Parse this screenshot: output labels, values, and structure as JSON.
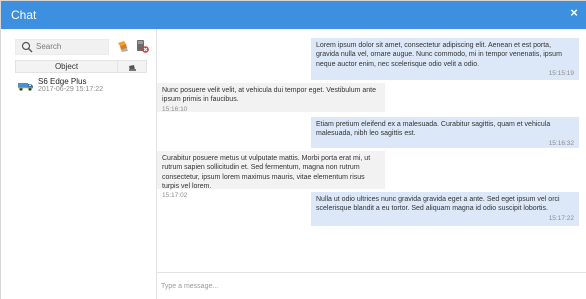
{
  "window": {
    "title": "Chat",
    "close_glyph": "×"
  },
  "sidebar": {
    "search_placeholder": "Search",
    "tools": [
      {
        "name": "vehicle-tool-icon"
      },
      {
        "name": "delete-tool-icon"
      }
    ],
    "grid": {
      "columns": [
        "Object",
        "image-icon"
      ],
      "rows": [
        {
          "name": "S6 Edge Plus",
          "time": "2017-06-29 15:17:22",
          "icon": "truck-icon"
        }
      ]
    }
  },
  "chat": {
    "messages": [
      {
        "dir": "out",
        "text": "Lorem ipsum dolor sit amet, consectetur adipiscing elit. Aenean et est porta, gravida nulla vel, ornare augue. Nunc commodo, mi in tempor venenatis, ipsum neque auctor enim, nec scelerisque odio velit a odio.",
        "time": "15:15:19"
      },
      {
        "dir": "in",
        "text": "Nunc posuere velit velit, at vehicula dui tempor eget. Vestibulum ante ipsum primis in faucibus.",
        "time": "15:16:10"
      },
      {
        "dir": "out",
        "text": "Etiam pretium eleifend ex a malesuada. Curabitur sagittis, quam et vehicula malesuada, nibh leo sagittis est.",
        "time": "15:16:32"
      },
      {
        "dir": "in",
        "text": "Curabitur posuere metus ut vulputate mattis. Morbi porta erat mi, ut rutrum sapien sollicitudin et. Sed fermentum, magna non rutrum consectetur, ipsum lorem maximus mauris, vitae elementum risus turpis vel lorem.",
        "time": "15:17:02"
      },
      {
        "dir": "out",
        "text": "Nulla ut odio ultrices nunc gravida gravida eget a ante. Sed eget ipsum vel orci scelerisque blandit a eu tortor. Sed aliquam magna id odio suscipit lobortis.",
        "time": "15:17:22"
      }
    ],
    "composer_placeholder": "Type a message..."
  },
  "colors": {
    "titlebar": "#3d8fe0",
    "outgoing": "#dce8f8",
    "incoming": "#f2f2f2",
    "vehicle": "#4a8fd6"
  }
}
